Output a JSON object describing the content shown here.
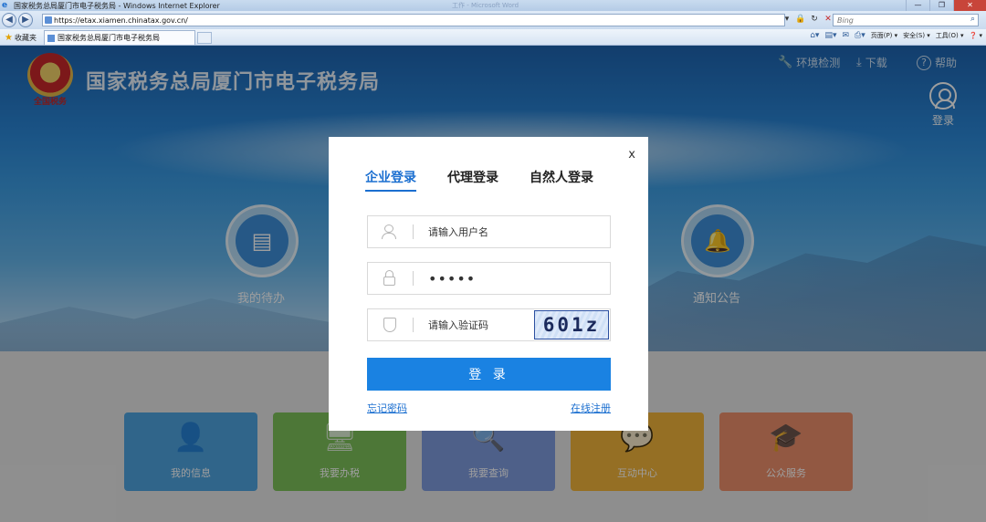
{
  "browser": {
    "window_title": "国家税务总局厦门市电子税务局 - Windows Internet Explorer",
    "ghost_title": "工作 - Microsoft Word",
    "url": "https://etax.xiamen.chinatax.gov.cn/",
    "search_placeholder": "Bing",
    "favorites_label": "收藏夹",
    "tab_title": "国家税务总局厦门市电子税务局",
    "commands": {
      "page": "页面(P) ▾",
      "safety": "安全(S) ▾",
      "tools": "工具(O) ▾",
      "help": "❓ ▾"
    }
  },
  "site": {
    "title": "国家税务总局厦门市电子税务局",
    "emblem_script": "全国税务",
    "env_check": "环境检测",
    "download": "下载",
    "help": "帮助",
    "login": "登录"
  },
  "hero": {
    "todo": "我的待办",
    "notice": "通知公告"
  },
  "tiles": [
    {
      "label": "我的信息",
      "icon": "person-icon"
    },
    {
      "label": "我要办税",
      "icon": "monitor-icon"
    },
    {
      "label": "我要查询",
      "icon": "search-doc-icon"
    },
    {
      "label": "互动中心",
      "icon": "chat-icon"
    },
    {
      "label": "公众服务",
      "icon": "service-icon"
    }
  ],
  "modal": {
    "close": "x",
    "tabs": [
      "企业登录",
      "代理登录",
      "自然人登录"
    ],
    "active_tab": 0,
    "username_placeholder": "请输入用户名",
    "password_value": "•••••",
    "captcha_placeholder": "请输入验证码",
    "captcha_text": "601z",
    "login_button": "登 录",
    "forgot_password": "忘记密码",
    "register": "在线注册"
  },
  "colors": {
    "accent": "#1a82e2",
    "tile_info": "#4ea3df",
    "tile_tax": "#7cc05a",
    "tile_query": "#7f9bde",
    "tile_interact": "#f0b33a",
    "tile_public": "#ec8f6b"
  }
}
